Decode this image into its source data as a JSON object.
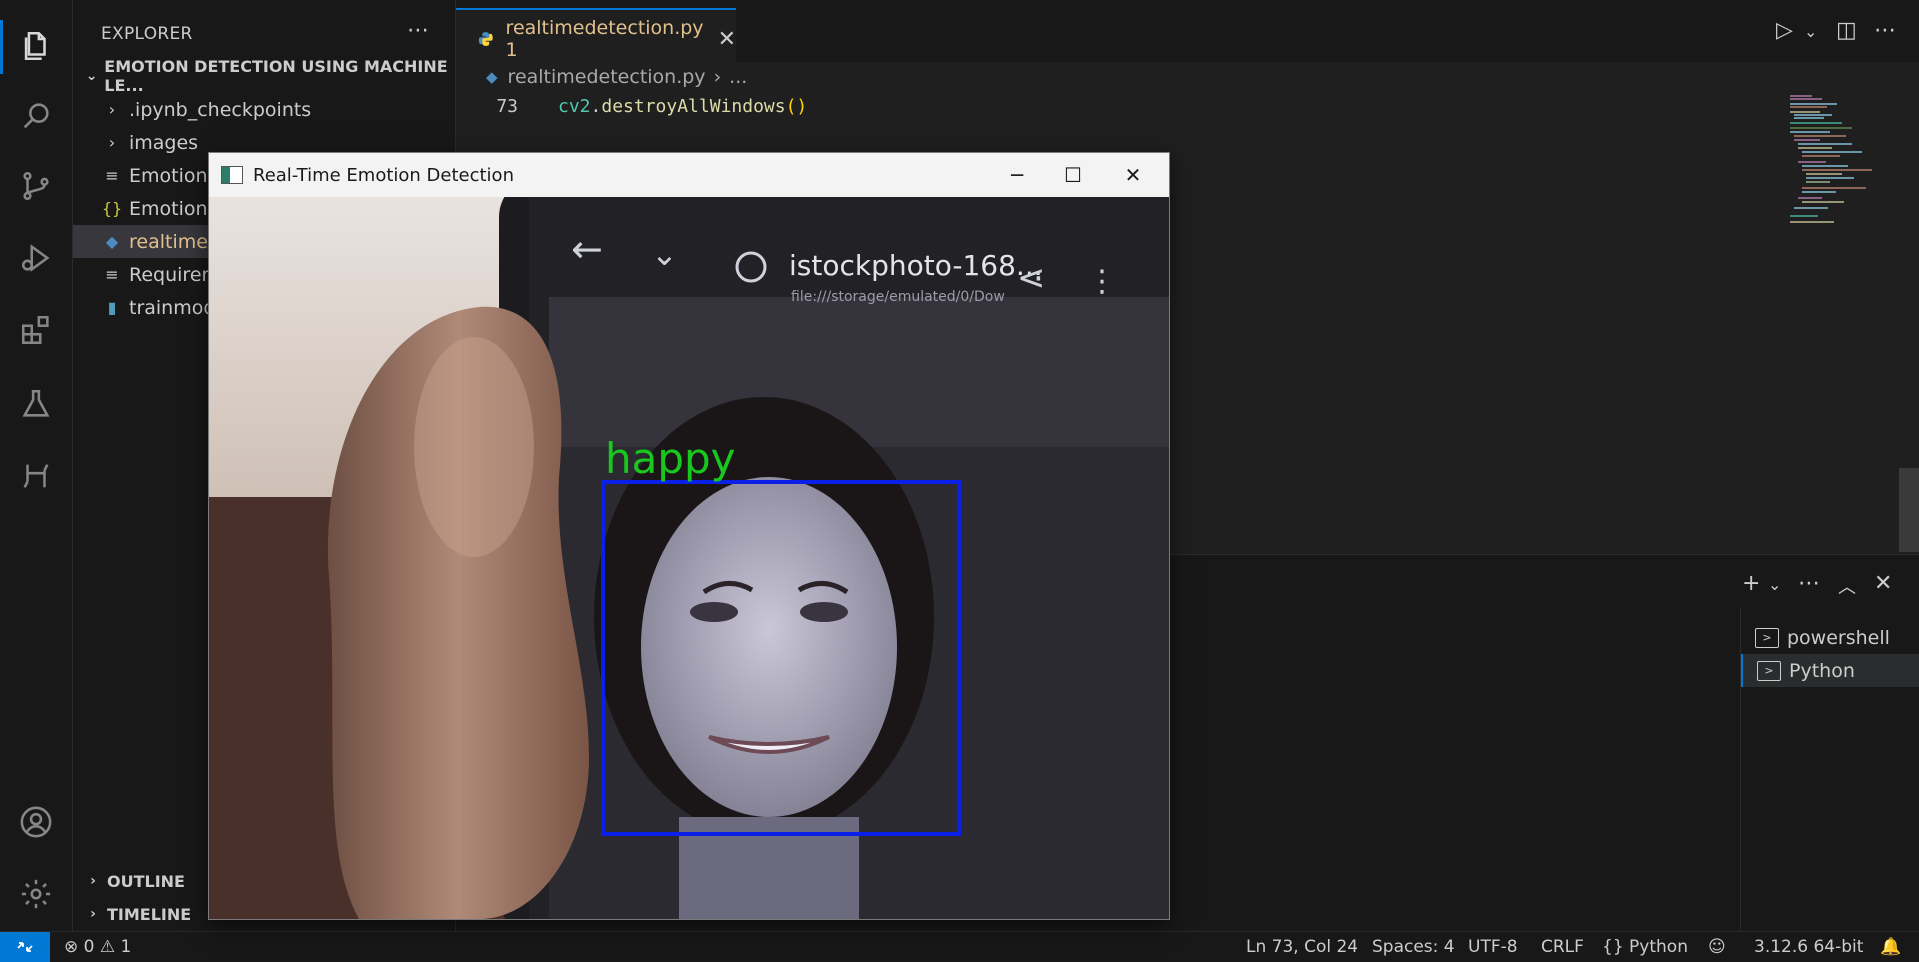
{
  "sidebar": {
    "title": "EXPLORER",
    "root_folder": "EMOTION DETECTION USING MACHINE LE...",
    "items": [
      {
        "label": ".ipynb_checkpoints",
        "type": "folder"
      },
      {
        "label": "images",
        "type": "folder"
      },
      {
        "label": "Emotion D",
        "type": "text"
      },
      {
        "label": "Emotion D",
        "type": "json"
      },
      {
        "label": "realtimede",
        "type": "python"
      },
      {
        "label": "Requireme",
        "type": "text"
      },
      {
        "label": "trainmode",
        "type": "notebook"
      }
    ],
    "outline": "OUTLINE",
    "timeline": "TIMELINE"
  },
  "tab": {
    "label": "realtimedetection.py 1",
    "close": "✕"
  },
  "breadcrumb": {
    "file": "realtimedetection.py",
    "sep": "›",
    "rest": "..."
  },
  "editor": {
    "line_number": "73",
    "code_obj": "cv2",
    "code_dot": ".",
    "code_fn": "destroyAllWindows",
    "code_paren": "()"
  },
  "panel": {
    "terminals": [
      "powershell",
      "Python"
    ]
  },
  "statusbar": {
    "problems_errors": "0",
    "problems_warnings": "1",
    "position": "Ln 73, Col 24",
    "spaces": "Spaces: 4",
    "encoding": "UTF-8",
    "eol": "CRLF",
    "language": "Python",
    "interpreter": "3.12.6 64-bit"
  },
  "cv_window": {
    "title": "Real-Time Emotion Detection",
    "emotion_label": "happy",
    "phone_title": "istockphoto-168...",
    "phone_path": "file:///storage/emulated/0/Dow"
  },
  "colors": {
    "accent": "#0078d4",
    "detect_box": "#0a1fe8",
    "label_green": "#19c81e",
    "modified_file": "#e2c08d"
  }
}
